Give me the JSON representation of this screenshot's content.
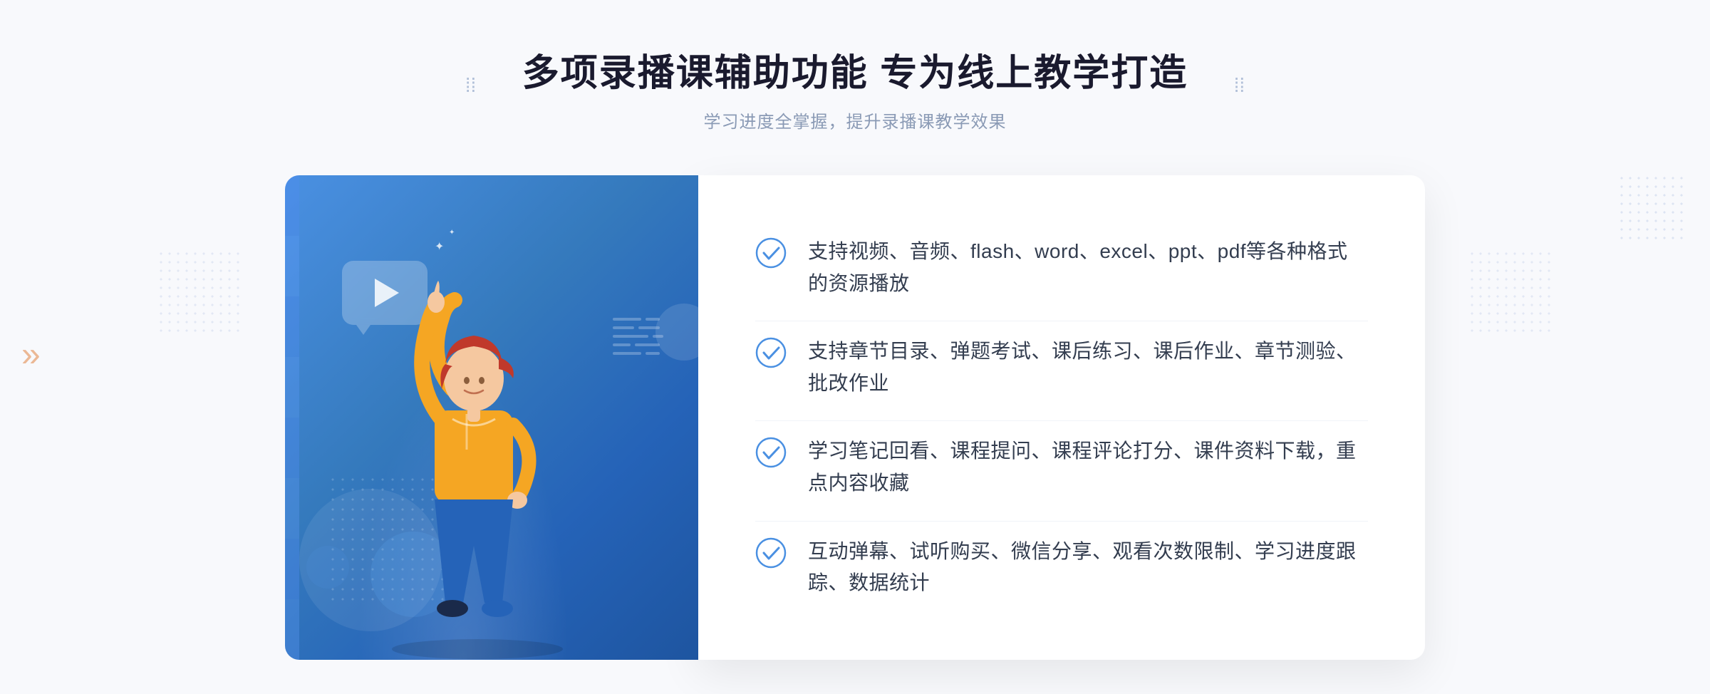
{
  "header": {
    "title": "多项录播课辅助功能 专为线上教学打造",
    "subtitle": "学习进度全掌握，提升录播课教学效果",
    "deco_left": "⁞⁞",
    "deco_right": "⁞⁞"
  },
  "features": [
    {
      "id": 1,
      "text": "支持视频、音频、flash、word、excel、ppt、pdf等各种格式的资源播放"
    },
    {
      "id": 2,
      "text": "支持章节目录、弹题考试、课后练习、课后作业、章节测验、批改作业"
    },
    {
      "id": 3,
      "text": "学习笔记回看、课程提问、课程评论打分、课件资料下载，重点内容收藏"
    },
    {
      "id": 4,
      "text": "互动弹幕、试听购买、微信分享、观看次数限制、学习进度跟踪、数据统计"
    }
  ],
  "illustration": {
    "alt": "录播课辅助功能插图"
  },
  "colors": {
    "accent_blue": "#4a90e2",
    "text_dark": "#1a1a2e",
    "text_mid": "#333d4f",
    "text_light": "#8a9ab5",
    "check_blue": "#4a90e2",
    "bg_page": "#f8f9fc"
  }
}
